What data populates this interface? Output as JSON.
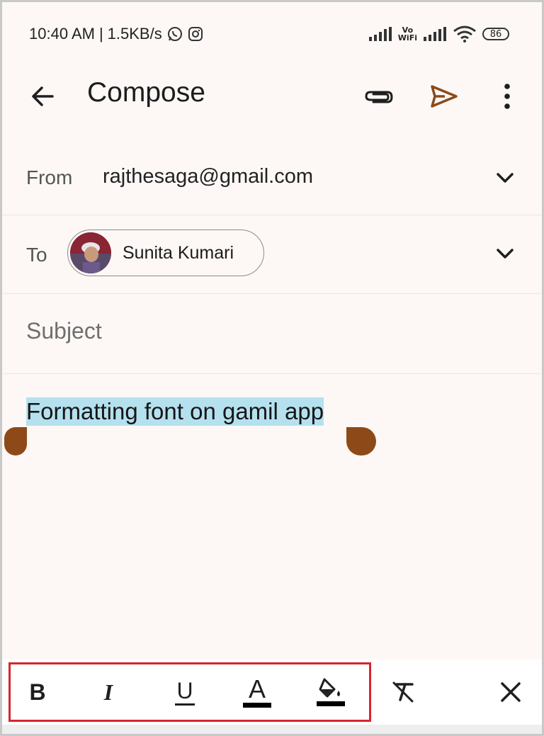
{
  "status_bar": {
    "time": "10:40 AM",
    "separator": "|",
    "speed": "1.5KB/s",
    "vowifi_top": "Vo",
    "vowifi_bottom": "WiFi",
    "battery": "86"
  },
  "app_bar": {
    "title": "Compose"
  },
  "from_row": {
    "label": "From",
    "value": "rajthesaga@gmail.com"
  },
  "to_row": {
    "label": "To",
    "recipient_name": "Sunita Kumari"
  },
  "subject": {
    "placeholder": "Subject"
  },
  "body": {
    "text": "Formatting font on gamil app"
  },
  "toolbar": {
    "bold_label": "B",
    "italic_label": "I",
    "underline_label": "U",
    "text_color_label": "A"
  },
  "colors": {
    "accent_brown": "#8d4a18",
    "selection_blue": "#b5e1ef",
    "highlight_red": "#d6262f",
    "background": "#fdf8f6"
  },
  "icons": {
    "back": "arrow-left",
    "attach": "paperclip",
    "send": "send-arrow",
    "more": "vertical-dots",
    "expand": "chevron-down",
    "fill": "paint-bucket",
    "clear_format": "format-clear",
    "close": "close-x"
  }
}
